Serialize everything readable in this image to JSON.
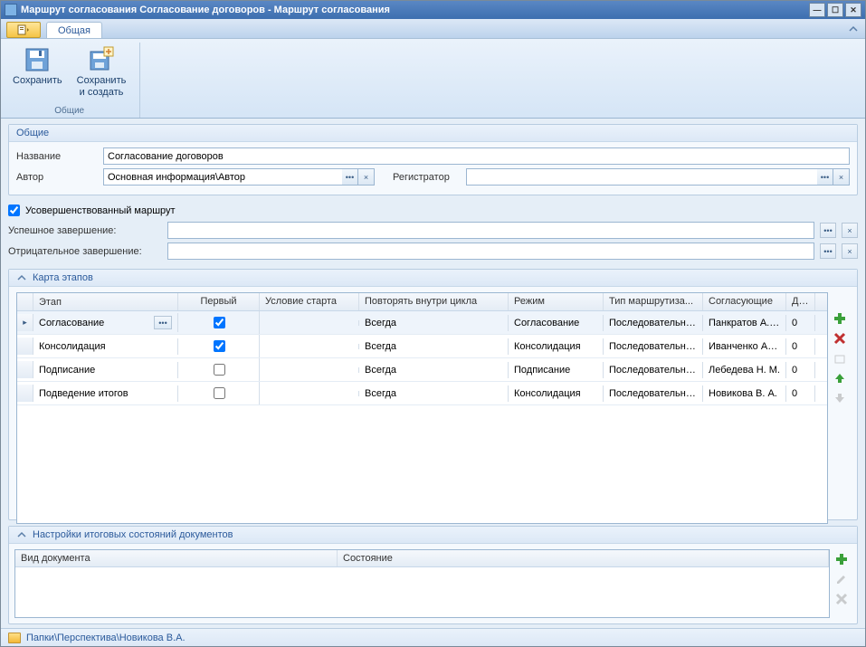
{
  "window": {
    "title": "Маршрут согласования Согласование договоров - Маршрут согласования"
  },
  "ribbon": {
    "tab_general": "Общая",
    "save": "Сохранить",
    "save_and_create_line1": "Сохранить",
    "save_and_create_line2": "и создать",
    "group_general": "Общие"
  },
  "general_panel": {
    "title": "Общие",
    "name_label": "Название",
    "name_value": "Согласование договоров",
    "author_label": "Автор",
    "author_value": "Основная информация\\Автор",
    "registrar_label": "Регистратор",
    "registrar_value": ""
  },
  "advanced_route": {
    "checkbox_label": "Усовершенствованный маршрут",
    "success_label": "Успешное завершение:",
    "success_value": "",
    "fail_label": "Отрицательное завершение:",
    "fail_value": ""
  },
  "stages_panel": {
    "title": "Карта этапов",
    "columns": {
      "stage": "Этап",
      "first": "Первый",
      "cond": "Условие старта",
      "repeat": "Повторять внутри цикла",
      "mode": "Режим",
      "routing": "Тип маршрутиза...",
      "approvers": "Согласующие",
      "dl": "Дл..."
    },
    "rows": [
      {
        "stage": "Согласование",
        "first": true,
        "cond": "",
        "repeat": "Всегда",
        "mode": "Согласование",
        "routing": "Последовательное",
        "approvers": "Панкратов А. Н.",
        "dl": "0",
        "selected": true
      },
      {
        "stage": "Консолидация",
        "first": true,
        "cond": "",
        "repeat": "Всегда",
        "mode": "Консолидация",
        "routing": "Последовательное",
        "approvers": "Иванченко А. С.",
        "dl": "0"
      },
      {
        "stage": "Подписание",
        "first": false,
        "cond": "",
        "repeat": "Всегда",
        "mode": "Подписание",
        "routing": "Последовательное",
        "approvers": "Лебедева Н. М.",
        "dl": "0"
      },
      {
        "stage": "Подведение итогов",
        "first": false,
        "cond": "",
        "repeat": "Всегда",
        "mode": "Консолидация",
        "routing": "Последовательное",
        "approvers": "Новикова В. А.",
        "dl": "0"
      }
    ]
  },
  "doc_states_panel": {
    "title": "Настройки итоговых состояний документов",
    "columns": {
      "doctype": "Вид документа",
      "state": "Состояние"
    }
  },
  "statusbar": {
    "path": "Папки\\Перспектива\\Новикова В.А."
  },
  "glyphs": {
    "ellipsis": "•••",
    "clear": "×",
    "chevron_up": "⌃",
    "row_marker": "▸"
  }
}
